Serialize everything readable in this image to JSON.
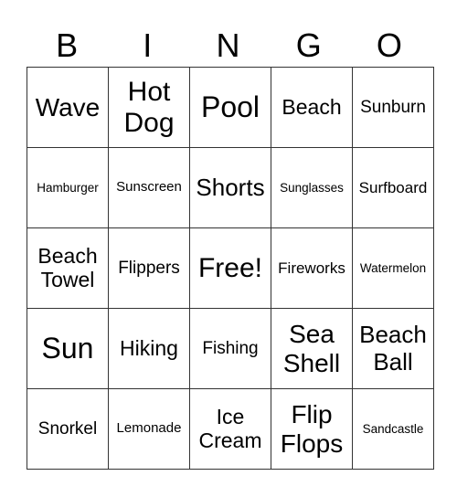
{
  "header": [
    "B",
    "I",
    "N",
    "G",
    "O"
  ],
  "rows": [
    [
      "Wave",
      "Hot Dog",
      "Pool",
      "Beach",
      "Sunburn"
    ],
    [
      "Hamburger",
      "Sunscreen",
      "Shorts",
      "Sunglasses",
      "Surfboard"
    ],
    [
      "Beach Towel",
      "Flippers",
      "Free!",
      "Fireworks",
      "Watermelon"
    ],
    [
      "Sun",
      "Hiking",
      "Fishing",
      "Sea Shell",
      "Beach Ball"
    ],
    [
      "Snorkel",
      "Lemonade",
      "Ice Cream",
      "Flip Flops",
      "Sandcastle"
    ]
  ]
}
